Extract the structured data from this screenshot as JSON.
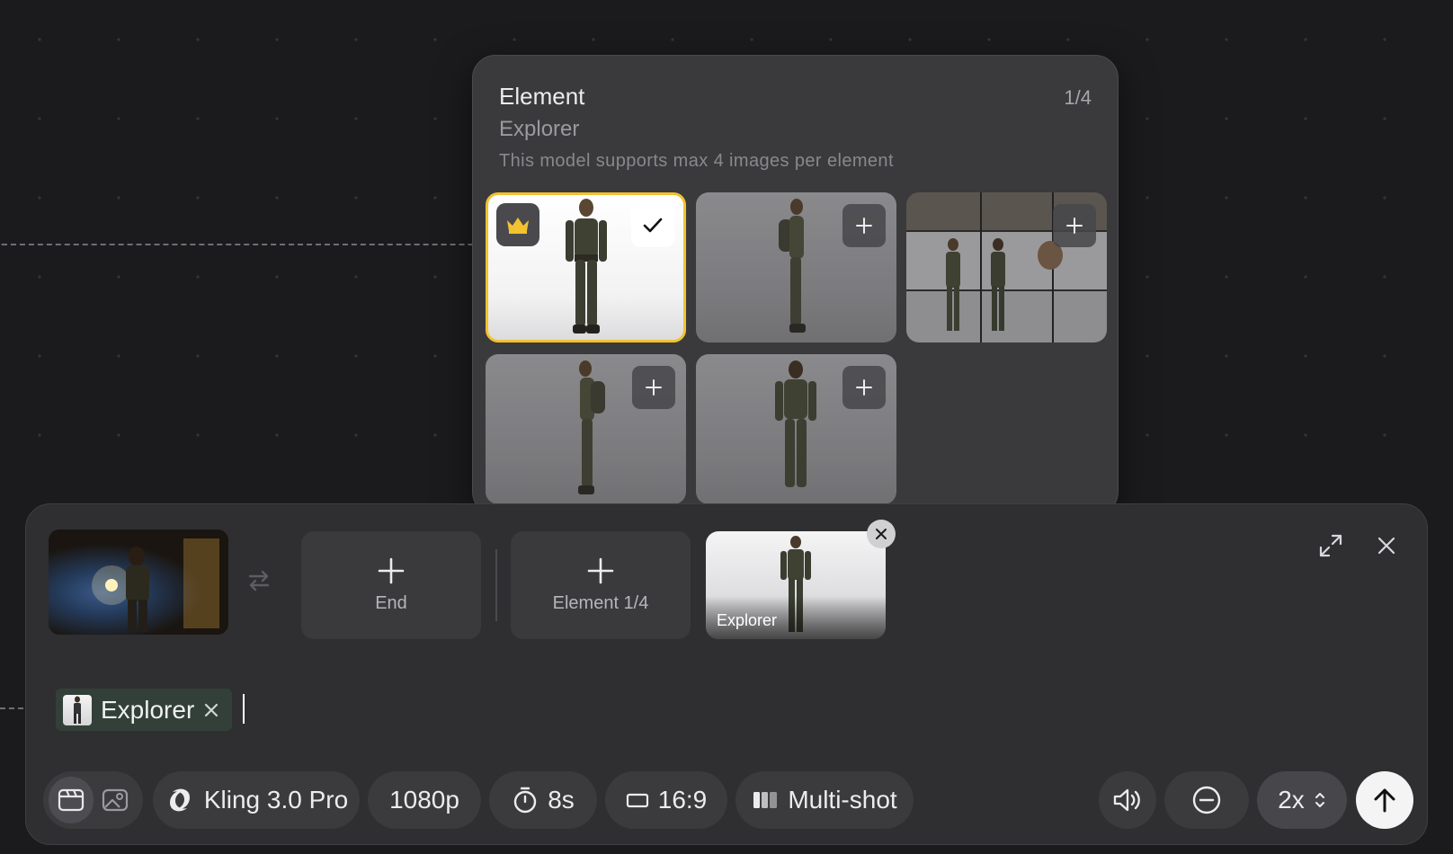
{
  "popover": {
    "title": "Element",
    "counter": "1/4",
    "subtitle": "Explorer",
    "hint": "This model supports max 4 images per element",
    "tiles": [
      {
        "view": "front",
        "selected": true,
        "primary": true
      },
      {
        "view": "side-right",
        "selected": false
      },
      {
        "view": "reference-sheet",
        "selected": false
      },
      {
        "view": "side-left",
        "selected": false
      },
      {
        "view": "back",
        "selected": false
      }
    ]
  },
  "composer": {
    "end_label": "End",
    "element_label": "Element 1/4",
    "element_card_label": "Explorer",
    "chip_label": "Explorer"
  },
  "toolbar": {
    "model": "Kling 3.0 Pro",
    "resolution": "1080p",
    "duration": "8s",
    "aspect_ratio": "16:9",
    "multishot": "Multi-shot",
    "speed": "2x"
  },
  "colors": {
    "accent_selected": "#f2c230",
    "background": "#1b1b1d",
    "panel": "#2f2f32",
    "chip": "#334039"
  },
  "icons": [
    "crown-icon",
    "check-icon",
    "plus-icon",
    "swap-icon",
    "expand-icon",
    "close-icon",
    "video-icon",
    "image-icon",
    "kling-logo-icon",
    "timer-icon",
    "aspect-ratio-icon",
    "multishot-icon",
    "volume-icon",
    "minus-circle-icon",
    "chevron-updown-icon",
    "arrow-up-icon"
  ]
}
